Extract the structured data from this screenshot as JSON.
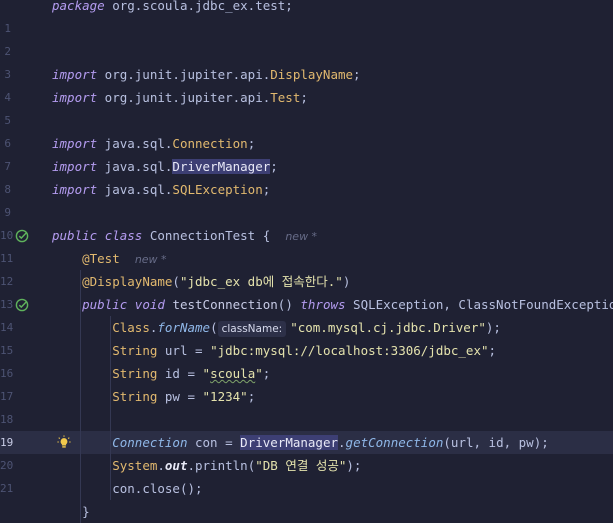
{
  "editor": {
    "lines": [
      {
        "num": "",
        "tokens": [
          {
            "t": "package",
            "c": "kw"
          },
          {
            "t": " org.scoula.jdbc_ex.test;",
            "c": "id"
          }
        ]
      },
      {
        "num": "1",
        "tokens": []
      },
      {
        "num": "2",
        "tokens": []
      },
      {
        "num": "3",
        "tokens": [
          {
            "t": "import",
            "c": "kw"
          },
          {
            "t": " org.junit.jupiter.api.",
            "c": "id"
          },
          {
            "t": "DisplayName",
            "c": "ty"
          },
          {
            "t": ";",
            "c": "id"
          }
        ]
      },
      {
        "num": "4",
        "tokens": [
          {
            "t": "import",
            "c": "kw"
          },
          {
            "t": " org.junit.jupiter.api.",
            "c": "id"
          },
          {
            "t": "Test",
            "c": "ty"
          },
          {
            "t": ";",
            "c": "id"
          }
        ]
      },
      {
        "num": "5",
        "tokens": []
      },
      {
        "num": "6",
        "tokens": [
          {
            "t": "import",
            "c": "kw"
          },
          {
            "t": " java.sql.",
            "c": "id"
          },
          {
            "t": "Connection",
            "c": "ty"
          },
          {
            "t": ";",
            "c": "id"
          }
        ]
      },
      {
        "num": "7",
        "tokens": [
          {
            "t": "import",
            "c": "kw"
          },
          {
            "t": " java.sql.",
            "c": "id"
          },
          {
            "t": "DriverManager",
            "c": "hl"
          },
          {
            "t": ";",
            "c": "id"
          }
        ]
      },
      {
        "num": "8",
        "tokens": [
          {
            "t": "import",
            "c": "kw"
          },
          {
            "t": " java.sql.",
            "c": "id"
          },
          {
            "t": "SQLException",
            "c": "ty"
          },
          {
            "t": ";",
            "c": "id"
          }
        ]
      },
      {
        "num": "9",
        "tokens": []
      },
      {
        "num": "10",
        "tokens": [
          {
            "t": "public",
            "c": "kw"
          },
          {
            "t": " ",
            "c": "id"
          },
          {
            "t": "class",
            "c": "kw"
          },
          {
            "t": " ConnectionTest {  ",
            "c": "id"
          },
          {
            "t": "new *",
            "c": "hint-usage"
          }
        ]
      },
      {
        "num": "11",
        "tokens": [
          {
            "t": "    ",
            "c": "id"
          },
          {
            "t": "@Test",
            "c": "ann"
          },
          {
            "t": "  ",
            "c": "id"
          },
          {
            "t": "new *",
            "c": "hint-usage"
          }
        ]
      },
      {
        "num": "12",
        "tokens": [
          {
            "t": "    ",
            "c": "id"
          },
          {
            "t": "@DisplayName",
            "c": "ann"
          },
          {
            "t": "(",
            "c": "id"
          },
          {
            "t": "\"jdbc_ex db에 접속한다.\"",
            "c": "str"
          },
          {
            "t": ")",
            "c": "id"
          }
        ]
      },
      {
        "num": "13",
        "tokens": [
          {
            "t": "    ",
            "c": "id"
          },
          {
            "t": "public",
            "c": "kw"
          },
          {
            "t": " ",
            "c": "id"
          },
          {
            "t": "void",
            "c": "kw"
          },
          {
            "t": " ",
            "c": "id"
          },
          {
            "t": "testConnection",
            "c": "fn"
          },
          {
            "t": "() ",
            "c": "id"
          },
          {
            "t": "throws",
            "c": "kw"
          },
          {
            "t": " SQLException, ClassNotFoundException {",
            "c": "id"
          }
        ]
      },
      {
        "num": "14",
        "tokens": [
          {
            "t": "        ",
            "c": "id"
          },
          {
            "t": "Class",
            "c": "ty"
          },
          {
            "t": ".",
            "c": "id"
          },
          {
            "t": "forName",
            "c": "method-it"
          },
          {
            "t": "(",
            "c": "id"
          },
          {
            "t": "className:",
            "c": "param-hint"
          },
          {
            "t": "\"com.mysql.cj.jdbc.Driver\"",
            "c": "str"
          },
          {
            "t": ");",
            "c": "id"
          }
        ]
      },
      {
        "num": "15",
        "tokens": [
          {
            "t": "        ",
            "c": "id"
          },
          {
            "t": "String",
            "c": "ty"
          },
          {
            "t": " url = ",
            "c": "id"
          },
          {
            "t": "\"jdbc:mysql://localhost:3306/jdbc_ex\"",
            "c": "str"
          },
          {
            "t": ";",
            "c": "id"
          }
        ]
      },
      {
        "num": "16",
        "tokens": [
          {
            "t": "        ",
            "c": "id"
          },
          {
            "t": "String",
            "c": "ty"
          },
          {
            "t": " id = ",
            "c": "id"
          },
          {
            "t": "\"",
            "c": "str"
          },
          {
            "t": "scoula",
            "c": "str squiggle"
          },
          {
            "t": "\"",
            "c": "str"
          },
          {
            "t": ";",
            "c": "id"
          }
        ]
      },
      {
        "num": "17",
        "tokens": [
          {
            "t": "        ",
            "c": "id"
          },
          {
            "t": "String",
            "c": "ty"
          },
          {
            "t": " pw = ",
            "c": "id"
          },
          {
            "t": "\"1234\"",
            "c": "str"
          },
          {
            "t": ";",
            "c": "id"
          }
        ]
      },
      {
        "num": "18",
        "tokens": []
      },
      {
        "num": "19",
        "current": true,
        "tokens": [
          {
            "t": "        ",
            "c": "id"
          },
          {
            "t": "Connection",
            "c": "ty-it"
          },
          {
            "t": " con = ",
            "c": "id"
          },
          {
            "t": "DriverManager",
            "c": "hl"
          },
          {
            "t": ".",
            "c": "id"
          },
          {
            "t": "getConnection",
            "c": "method-it"
          },
          {
            "t": "(url, id, pw);",
            "c": "id"
          }
        ]
      },
      {
        "num": "20",
        "tokens": [
          {
            "t": "        ",
            "c": "id"
          },
          {
            "t": "System",
            "c": "ty"
          },
          {
            "t": ".",
            "c": "id"
          },
          {
            "t": "out",
            "c": "field"
          },
          {
            "t": ".println(",
            "c": "id"
          },
          {
            "t": "\"DB 연결 성공\"",
            "c": "str"
          },
          {
            "t": ");",
            "c": "id"
          }
        ]
      },
      {
        "num": "21",
        "tokens": [
          {
            "t": "        ",
            "c": "id"
          },
          {
            "t": "con.close();",
            "c": "id"
          }
        ]
      },
      {
        "num": "",
        "tokens": [
          {
            "t": "    }",
            "c": "id"
          }
        ]
      }
    ],
    "gutter_icons": {
      "10": "run-test-check-icon",
      "13": "run-test-check-icon",
      "19": "lightbulb-icon"
    }
  }
}
